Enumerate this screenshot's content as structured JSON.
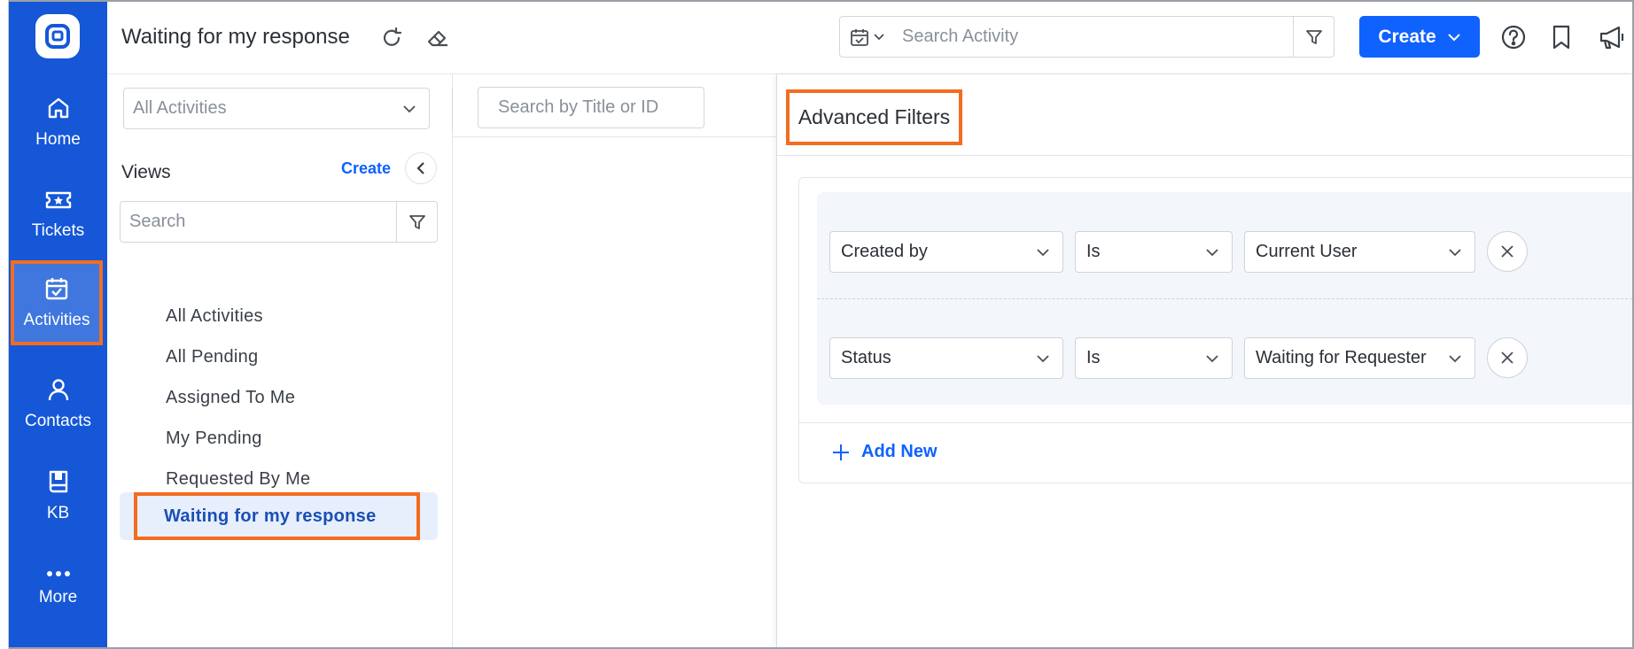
{
  "nav": {
    "items": [
      {
        "label": "Home",
        "icon": "home-icon"
      },
      {
        "label": "Tickets",
        "icon": "ticket-icon"
      },
      {
        "label": "Activities",
        "icon": "calendar-check-icon"
      },
      {
        "label": "Contacts",
        "icon": "user-icon"
      },
      {
        "label": "KB",
        "icon": "book-icon"
      },
      {
        "label": "More",
        "icon": "more-dots-icon"
      }
    ],
    "active": "Activities"
  },
  "header": {
    "title": "Waiting for my response",
    "search_placeholder": "Search Activity",
    "create_label": "Create"
  },
  "views": {
    "filter_select": "All Activities",
    "label": "Views",
    "create_link": "Create",
    "search_placeholder": "Search",
    "items": [
      {
        "label": "All Activities"
      },
      {
        "label": "All Pending"
      },
      {
        "label": "Assigned To Me"
      },
      {
        "label": "My Pending"
      },
      {
        "label": "Requested By Me"
      },
      {
        "label": "Waiting for my response"
      }
    ],
    "active": "Waiting for my response"
  },
  "list": {
    "search_placeholder": "Search by Title or ID"
  },
  "advanced_filters": {
    "title": "Advanced Filters",
    "rows": [
      {
        "field": "Created by",
        "operator": "Is",
        "value": "Current User"
      },
      {
        "field": "Status",
        "operator": "Is",
        "value": "Waiting for Requester"
      }
    ],
    "add_new_label": "Add New"
  },
  "colors": {
    "nav_bg": "#1557d6",
    "accent": "#0f62fe",
    "highlight": "#f26d21"
  }
}
